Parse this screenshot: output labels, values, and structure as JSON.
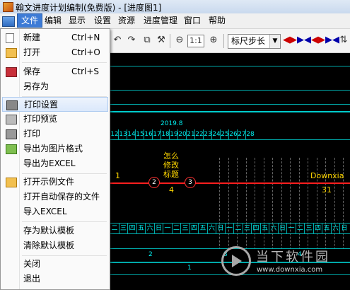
{
  "window": {
    "title": "翰文进度计划编制(免费版) - [进度图1]"
  },
  "menubar": {
    "items": [
      "文件",
      "编辑",
      "显示",
      "设置",
      "资源",
      "进度管理",
      "窗口",
      "帮助"
    ],
    "active": "文件"
  },
  "toolbar": {
    "zoom_label": "1:1",
    "ruler_select": "标尺步长"
  },
  "file_menu": {
    "items": [
      {
        "label": "新建",
        "shortcut": "Ctrl+N",
        "icon": "new-file-icon"
      },
      {
        "label": "打开",
        "shortcut": "Ctrl+O",
        "icon": "open-folder-icon"
      },
      {
        "label": "保存",
        "shortcut": "Ctrl+S",
        "icon": "save-icon"
      },
      {
        "label": "另存为",
        "shortcut": "",
        "icon": ""
      },
      {
        "label": "打印设置",
        "shortcut": "",
        "icon": "print-setup-icon",
        "highlighted": true
      },
      {
        "label": "打印预览",
        "shortcut": "",
        "icon": "print-preview-icon"
      },
      {
        "label": "打印",
        "shortcut": "",
        "icon": "printer-icon"
      },
      {
        "label": "导出为图片格式",
        "shortcut": "",
        "icon": "export-image-icon"
      },
      {
        "label": "导出为EXCEL",
        "shortcut": "",
        "icon": ""
      },
      {
        "label": "打开示例文件",
        "shortcut": "",
        "icon": "sample-folder-icon"
      },
      {
        "label": "打开自动保存的文件",
        "shortcut": "",
        "icon": ""
      },
      {
        "label": "导入EXCEL",
        "shortcut": "",
        "icon": ""
      },
      {
        "label": "存为默认模板",
        "shortcut": "",
        "icon": ""
      },
      {
        "label": "清除默认模板",
        "shortcut": "",
        "icon": ""
      },
      {
        "label": "关闭",
        "shortcut": "",
        "icon": ""
      },
      {
        "label": "退出",
        "shortcut": "",
        "icon": ""
      }
    ]
  },
  "chart": {
    "month_label": "2019.8",
    "day_numbers": [
      "12",
      "13",
      "14",
      "15",
      "16",
      "17",
      "18",
      "19",
      "20",
      "21",
      "22",
      "23",
      "24",
      "25",
      "26",
      "27",
      "28"
    ],
    "weekday_row": [
      "二",
      "三",
      "四",
      "五",
      "六",
      "日",
      "一",
      "二",
      "三",
      "四",
      "五",
      "六",
      "日",
      "一",
      "二",
      "三",
      "四",
      "五",
      "六",
      "日",
      "一",
      "二",
      "三",
      "四",
      "五",
      "六",
      "日"
    ],
    "task_note": [
      "怎么",
      "修改",
      "标题"
    ],
    "task_duration": "4",
    "right_task_name": "Downxia",
    "right_task_duration": "31",
    "left_fragment": "1",
    "nodes": [
      "2",
      "3"
    ],
    "bottom_numbers": [
      "2",
      "3",
      "4"
    ],
    "bottom_row2": "1"
  },
  "watermark": {
    "brand": "当下软件园",
    "url": "www.downxia.com"
  },
  "colors": {
    "menu_highlight": "#dbe8fb",
    "annotation_box": "#e8141c",
    "grid_cyan": "#00aaaa",
    "task_line": "#ff1f1f",
    "task_note": "#ffd700"
  }
}
